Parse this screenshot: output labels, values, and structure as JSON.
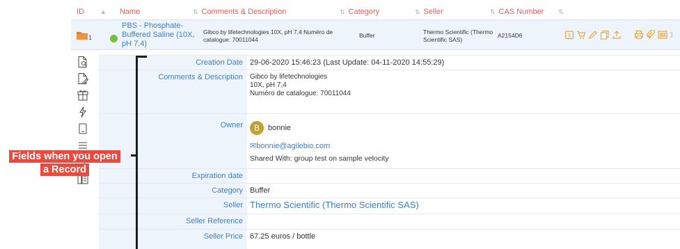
{
  "table_header": {
    "id": "ID",
    "name": "Name",
    "comments": "Comments & Description",
    "category": "Category",
    "seller": "Seller",
    "cas_number": "CAS Number"
  },
  "record": {
    "number": "1",
    "name": "PBS - Phosphate-Buffered Saline (10X, pH 7.4)",
    "comment": "Gibco by lifetechnologies 10X, pH 7,4 Numéro de catalogue: 70011044",
    "category": "Buffer",
    "seller": "Thermo Scientific (Thermo Scientific SAS)",
    "cas_number": "A2154D6",
    "status_color": "#77bf3c"
  },
  "details": {
    "creation_date_label": "Creation Date",
    "creation_date_value": "29-06-2020 15:46:23 (Last Update: 04-11-2020 14:55:29)",
    "comments_label": "Comments & Description",
    "comments_line1": "Gibco by lifetechnologies",
    "comments_line2": "10X, pH 7,4",
    "comments_line3": "Numéro de catalogue:  70011044",
    "owner_label": "Owner",
    "owner_initial": "B",
    "owner_name": "bonnie",
    "owner_email": "bonnie@agilebio.com",
    "shared_with": "Shared With: group test on sample velocity",
    "expiration_label": "Expiration date",
    "expiration_value": "",
    "category_label": "Category",
    "category_value": "Buffer",
    "seller_label": "Seller",
    "seller_value": "Thermo Scientific (Thermo Scientific SAS)",
    "seller_reference_label": "Seller Reference",
    "seller_reference_value": "",
    "seller_price_label": "Seller Price",
    "seller_price_value": "67.25 euros / bottle"
  },
  "annotation": {
    "line1": "Fields when you open",
    "line2": "a Record"
  },
  "colors": {
    "header_text": "#e0605a",
    "link": "#3d7ec5",
    "row_bg": "#eef4fb",
    "avatar": "#c3a02f",
    "action_icon": "#e8a53c",
    "callout_bg": "#e84a3f"
  }
}
